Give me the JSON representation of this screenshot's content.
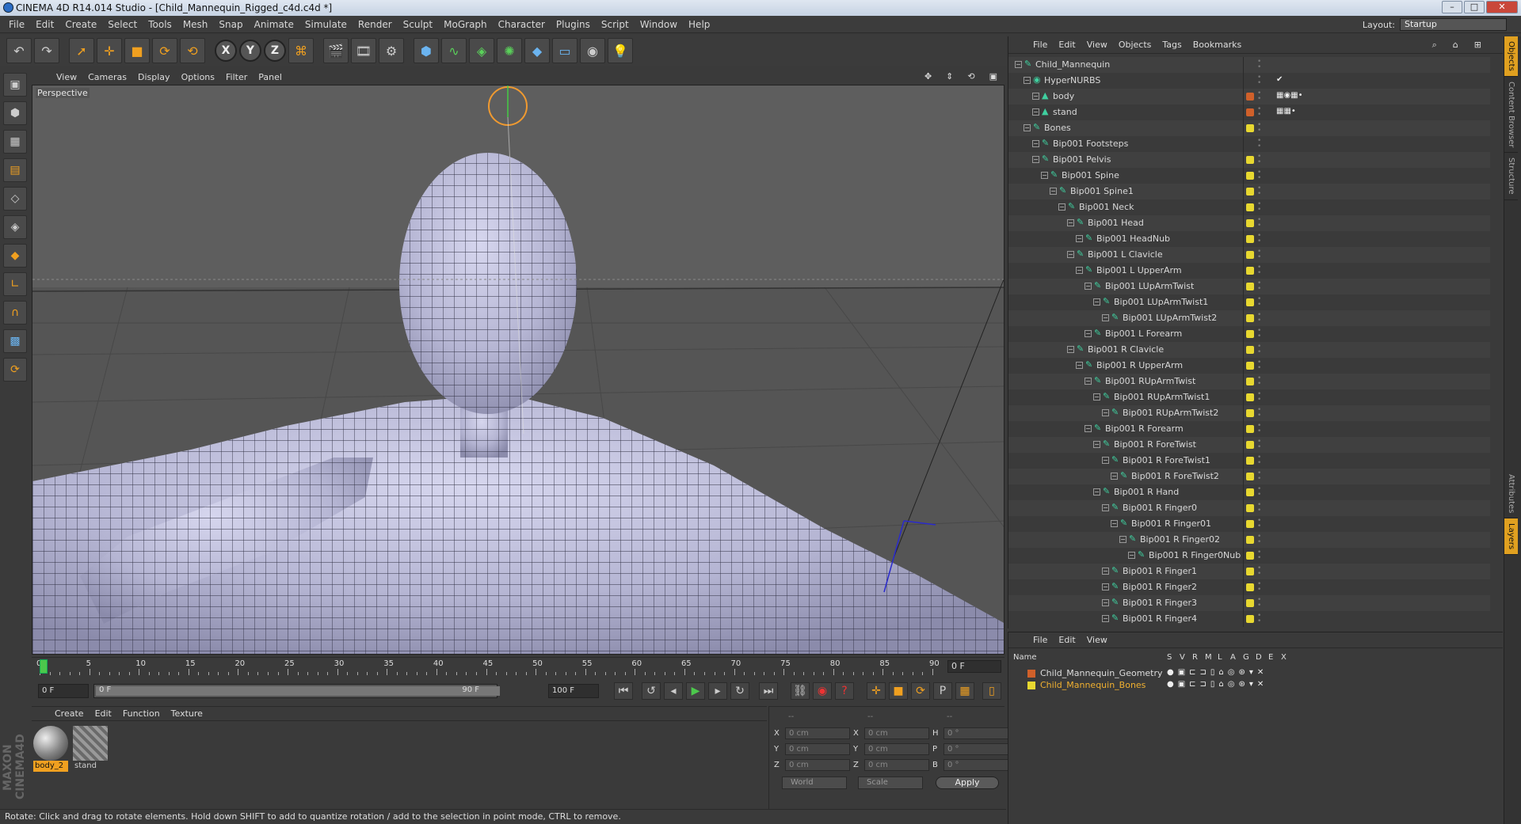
{
  "window": {
    "title": "CINEMA 4D R14.014 Studio - [Child_Mannequin_Rigged_c4d.c4d *]"
  },
  "menubar": [
    "File",
    "Edit",
    "Create",
    "Select",
    "Tools",
    "Mesh",
    "Snap",
    "Animate",
    "Simulate",
    "Render",
    "Sculpt",
    "MoGraph",
    "Character",
    "Plugins",
    "Script",
    "Window",
    "Help"
  ],
  "layout": {
    "label": "Layout:",
    "value": "Startup"
  },
  "viewport": {
    "menu": [
      "View",
      "Cameras",
      "Display",
      "Options",
      "Filter",
      "Panel"
    ],
    "label": "Perspective"
  },
  "timeline": {
    "ticks": [
      "0",
      "5",
      "10",
      "15",
      "20",
      "25",
      "30",
      "35",
      "40",
      "45",
      "50",
      "55",
      "60",
      "65",
      "70",
      "75",
      "80",
      "85",
      "90"
    ],
    "current_frame": "0 F"
  },
  "transport": {
    "start": "0 F",
    "range_start": "0 F",
    "range_end": "90 F",
    "end": "100 F"
  },
  "materials": {
    "menu": [
      "Create",
      "Edit",
      "Function",
      "Texture"
    ],
    "items": [
      {
        "name": "body_2"
      },
      {
        "name": "stand"
      }
    ]
  },
  "coords": {
    "header": [
      "--",
      "--",
      "--"
    ],
    "rows": [
      {
        "a": "X",
        "av": "0 cm",
        "b": "X",
        "bv": "0 cm",
        "c": "H",
        "cv": "0 °"
      },
      {
        "a": "Y",
        "av": "0 cm",
        "b": "Y",
        "bv": "0 cm",
        "c": "P",
        "cv": "0 °"
      },
      {
        "a": "Z",
        "av": "0 cm",
        "b": "Z",
        "bv": "0 cm",
        "c": "B",
        "cv": "0 °"
      }
    ],
    "world": "World",
    "scale": "Scale",
    "apply": "Apply"
  },
  "status": "Rotate: Click and drag to rotate elements. Hold down SHIFT to add to quantize rotation / add to the selection in point mode, CTRL to remove.",
  "objects": {
    "menu": [
      "File",
      "Edit",
      "View",
      "Objects",
      "Tags",
      "Bookmarks"
    ],
    "tree": [
      {
        "name": "Child_Mannequin",
        "depth": 0,
        "tag": ""
      },
      {
        "name": "HyperNURBS",
        "depth": 1,
        "tag": "",
        "extra": "✔"
      },
      {
        "name": "body",
        "depth": 2,
        "tag": "#d0602a",
        "extra": "▦◉▦•"
      },
      {
        "name": "stand",
        "depth": 2,
        "tag": "#d0602a",
        "extra": "▦▦•"
      },
      {
        "name": "Bones",
        "depth": 1,
        "tag": "#e8d830"
      },
      {
        "name": "Bip001 Footsteps",
        "depth": 2,
        "tag": ""
      },
      {
        "name": "Bip001 Pelvis",
        "depth": 2,
        "tag": "#e8d830"
      },
      {
        "name": "Bip001 Spine",
        "depth": 3,
        "tag": "#e8d830"
      },
      {
        "name": "Bip001 Spine1",
        "depth": 4,
        "tag": "#e8d830"
      },
      {
        "name": "Bip001 Neck",
        "depth": 5,
        "tag": "#e8d830"
      },
      {
        "name": "Bip001 Head",
        "depth": 6,
        "tag": "#e8d830"
      },
      {
        "name": "Bip001 HeadNub",
        "depth": 7,
        "tag": "#e8d830"
      },
      {
        "name": "Bip001 L Clavicle",
        "depth": 6,
        "tag": "#e8d830"
      },
      {
        "name": "Bip001 L UpperArm",
        "depth": 7,
        "tag": "#e8d830"
      },
      {
        "name": "Bip001 LUpArmTwist",
        "depth": 8,
        "tag": "#e8d830"
      },
      {
        "name": "Bip001 LUpArmTwist1",
        "depth": 9,
        "tag": "#e8d830"
      },
      {
        "name": "Bip001 LUpArmTwist2",
        "depth": 10,
        "tag": "#e8d830"
      },
      {
        "name": "Bip001 L Forearm",
        "depth": 8,
        "tag": "#e8d830"
      },
      {
        "name": "Bip001 R Clavicle",
        "depth": 6,
        "tag": "#e8d830"
      },
      {
        "name": "Bip001 R UpperArm",
        "depth": 7,
        "tag": "#e8d830"
      },
      {
        "name": "Bip001 RUpArmTwist",
        "depth": 8,
        "tag": "#e8d830"
      },
      {
        "name": "Bip001 RUpArmTwist1",
        "depth": 9,
        "tag": "#e8d830"
      },
      {
        "name": "Bip001 RUpArmTwist2",
        "depth": 10,
        "tag": "#e8d830"
      },
      {
        "name": "Bip001 R Forearm",
        "depth": 8,
        "tag": "#e8d830"
      },
      {
        "name": "Bip001 R ForeTwist",
        "depth": 9,
        "tag": "#e8d830"
      },
      {
        "name": "Bip001 R ForeTwist1",
        "depth": 10,
        "tag": "#e8d830"
      },
      {
        "name": "Bip001 R ForeTwist2",
        "depth": 11,
        "tag": "#e8d830"
      },
      {
        "name": "Bip001 R Hand",
        "depth": 9,
        "tag": "#e8d830"
      },
      {
        "name": "Bip001 R Finger0",
        "depth": 10,
        "tag": "#e8d830"
      },
      {
        "name": "Bip001 R Finger01",
        "depth": 11,
        "tag": "#e8d830"
      },
      {
        "name": "Bip001 R Finger02",
        "depth": 12,
        "tag": "#e8d830"
      },
      {
        "name": "Bip001 R Finger0Nub",
        "depth": 13,
        "tag": "#e8d830"
      },
      {
        "name": "Bip001 R Finger1",
        "depth": 10,
        "tag": "#e8d830"
      },
      {
        "name": "Bip001 R Finger2",
        "depth": 10,
        "tag": "#e8d830"
      },
      {
        "name": "Bip001 R Finger3",
        "depth": 10,
        "tag": "#e8d830"
      },
      {
        "name": "Bip001 R Finger4",
        "depth": 10,
        "tag": "#e8d830"
      }
    ]
  },
  "layers": {
    "menu": [
      "File",
      "Edit",
      "View"
    ],
    "header": {
      "name": "Name",
      "cols": [
        "S",
        "V",
        "R",
        "M",
        "L",
        "A",
        "G",
        "D",
        "E",
        "X"
      ]
    },
    "rows": [
      {
        "name": "Child_Mannequin_Geometry",
        "color": "#d0602a",
        "text_color": "#dddddd"
      },
      {
        "name": "Child_Mannequin_Bones",
        "color": "#e8d830",
        "text_color": "#f0b030"
      }
    ]
  },
  "sidetabs": [
    "Objects",
    "Content Browser",
    "Structure",
    "Attributes",
    "Layers"
  ]
}
